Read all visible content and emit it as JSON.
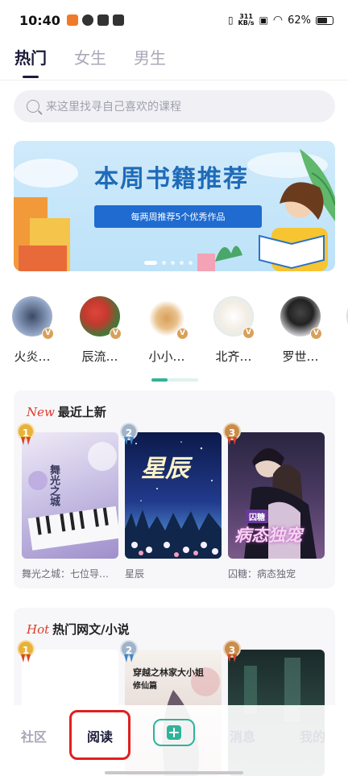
{
  "status_bar": {
    "time": "10:40",
    "net_speed_value": "311",
    "net_speed_unit": "KB/s",
    "battery": "62%"
  },
  "top_tabs": [
    {
      "label": "热门",
      "active": true
    },
    {
      "label": "女生",
      "active": false
    },
    {
      "label": "男生",
      "active": false
    }
  ],
  "search": {
    "placeholder": "来这里找寻自己喜欢的课程"
  },
  "banner": {
    "title": "本周书籍推荐",
    "subtitle": "每两周推荐5个优秀作品",
    "page_count": 5,
    "active_page": 1
  },
  "authors": [
    {
      "name": "火炎…",
      "verified": "V"
    },
    {
      "name": "辰流…",
      "verified": "V"
    },
    {
      "name": "小小…",
      "verified": "V"
    },
    {
      "name": "北齐…",
      "verified": "V"
    },
    {
      "name": "罗世…",
      "verified": "V"
    }
  ],
  "section_new": {
    "tag": "New",
    "title": "最近上新",
    "books": [
      {
        "rank": "1",
        "title": "舞光之城：七位导…",
        "cover_text": "舞光之城"
      },
      {
        "rank": "2",
        "title": "星辰",
        "cover_text": "星辰"
      },
      {
        "rank": "3",
        "title": "囚糖：病态独宠",
        "cover_text": "病态独宠",
        "cover_tag": "囚糖"
      }
    ]
  },
  "section_hot": {
    "tag": "Hot",
    "title": "热门网文/小说",
    "books": [
      {
        "rank": "1"
      },
      {
        "rank": "2",
        "cover_text": "穿越之林家大小姐",
        "cover_sub": "修仙篇"
      },
      {
        "rank": "3"
      }
    ]
  },
  "bottom_nav": [
    {
      "label": "社区"
    },
    {
      "label": "阅读",
      "active": true
    },
    {
      "label": "消息"
    },
    {
      "label": "我的"
    }
  ],
  "colors": {
    "accent": "#2fb39a",
    "dark_text": "#1b1b3a",
    "new_tag": "#e03a2a",
    "highlight": "#e02020",
    "banner_blue": "#1f6bb8"
  }
}
